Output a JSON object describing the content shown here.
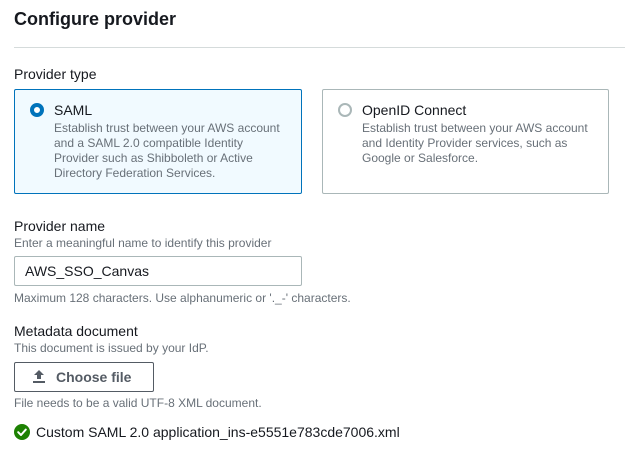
{
  "page": {
    "title": "Configure provider"
  },
  "provider_type": {
    "label": "Provider type",
    "options": [
      {
        "title": "SAML",
        "selected": true,
        "description_lines": [
          "Establish trust between your AWS account",
          "and a SAML 2.0 compatible Identity",
          "Provider such as Shibboleth or Active",
          "Directory Federation Services."
        ]
      },
      {
        "title": "OpenID Connect",
        "selected": false,
        "description_lines": [
          "Establish trust between your AWS account",
          "and Identity Provider services, such as",
          "Google or Salesforce."
        ]
      }
    ]
  },
  "provider_name": {
    "label": "Provider name",
    "description": "Enter a meaningful name to identify this provider",
    "value": "AWS_SSO_Canvas",
    "constraint": "Maximum 128 characters. Use alphanumeric or '._-' characters."
  },
  "metadata": {
    "label": "Metadata document",
    "description": "This document is issued by your IdP.",
    "button_label": "Choose file",
    "button_icon": "upload-icon",
    "constraint": "File needs to be a valid UTF-8 XML document.",
    "file_name": "Custom SAML 2.0 application_ins-e5551e783cde7006.xml",
    "file_status_icon": "check-circle-icon"
  },
  "colors": {
    "accent": "#0073bb",
    "success": "#1d8102",
    "text": "#16191f",
    "secondary_text": "#687078"
  }
}
